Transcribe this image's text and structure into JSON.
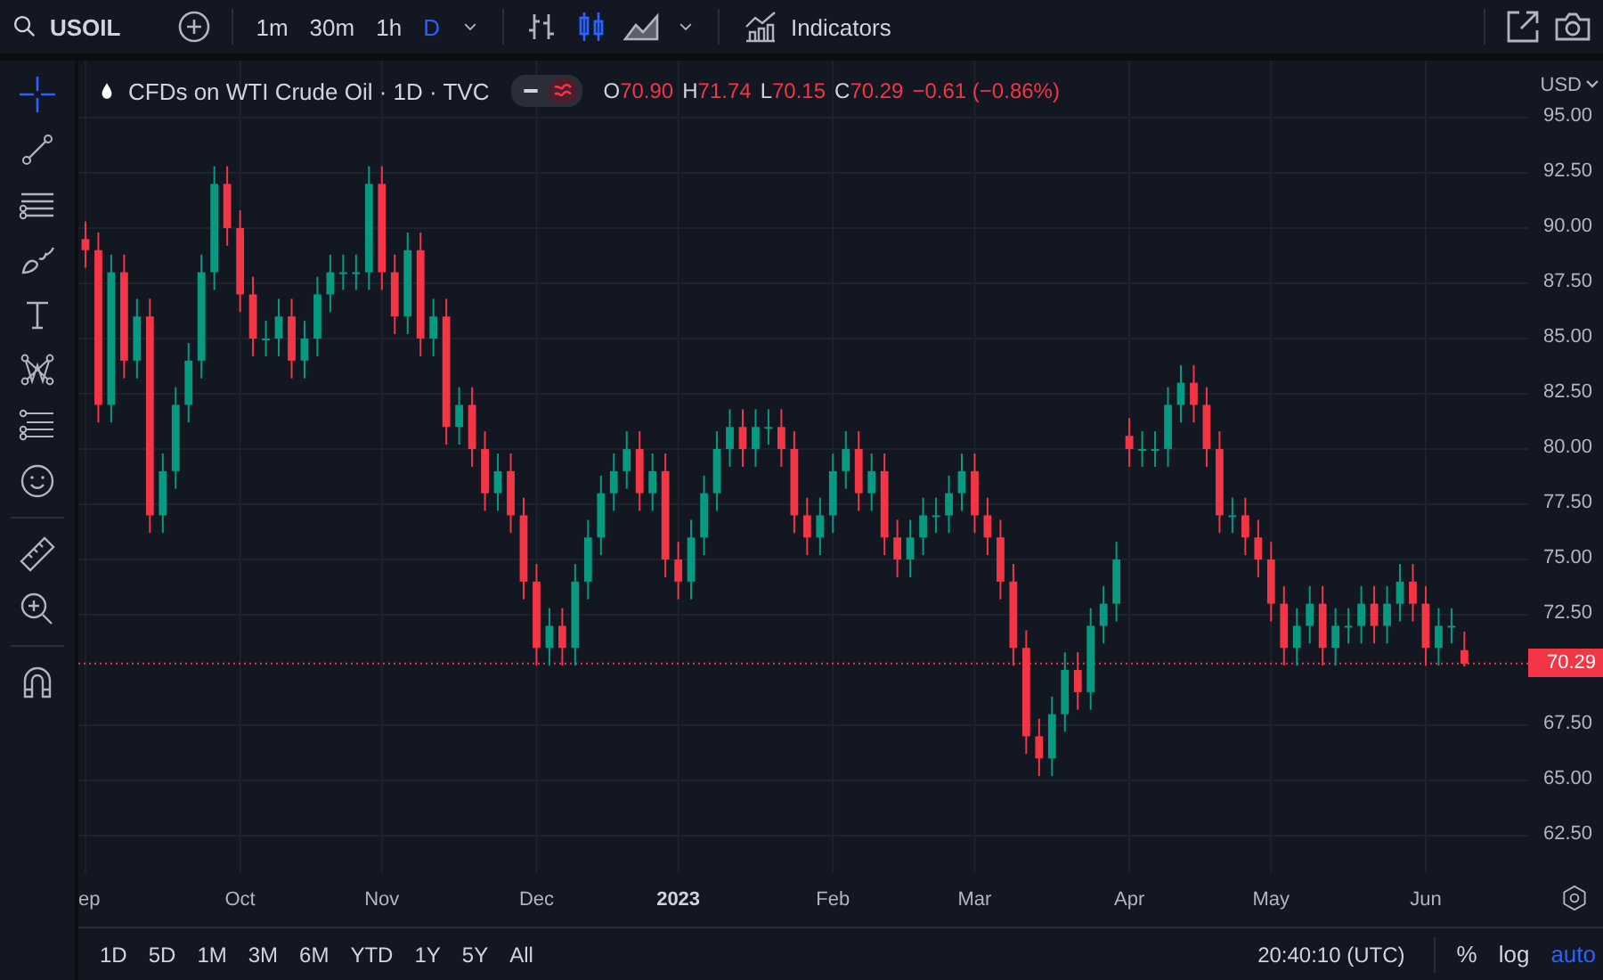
{
  "toolbar": {
    "symbol": "USOIL",
    "intervals": [
      {
        "label": "1m",
        "selected": false
      },
      {
        "label": "30m",
        "selected": false
      },
      {
        "label": "1h",
        "selected": false
      },
      {
        "label": "D",
        "selected": true
      }
    ],
    "chart_styles": [
      {
        "kind": "bars",
        "selected": false
      },
      {
        "kind": "candles",
        "selected": true
      },
      {
        "kind": "area",
        "selected": false
      }
    ],
    "indicators_label": "Indicators"
  },
  "legend": {
    "title": "CFDs on WTI Crude Oil · 1D · TVC",
    "toggles": [
      {
        "kind": "minus",
        "on": false
      },
      {
        "kind": "wave",
        "on": true
      }
    ],
    "ohlc": [
      {
        "key": "O",
        "value": "70.90"
      },
      {
        "key": "H",
        "value": "71.74"
      },
      {
        "key": "L",
        "value": "70.15"
      },
      {
        "key": "C",
        "value": "70.29"
      }
    ],
    "change": "−0.61 (−0.86%)"
  },
  "price_axis": {
    "currency": "USD",
    "last_price": "70.29"
  },
  "chart_data": {
    "type": "candlestick",
    "grid": true,
    "ylim": [
      60.81,
      97.58
    ],
    "categories": [
      "ep",
      null,
      null,
      null,
      null,
      null,
      null,
      null,
      null,
      null,
      null,
      null,
      "Oct",
      null,
      null,
      null,
      null,
      null,
      null,
      null,
      null,
      null,
      null,
      "Nov",
      null,
      null,
      null,
      null,
      null,
      null,
      null,
      null,
      null,
      null,
      null,
      "Dec",
      null,
      null,
      null,
      null,
      null,
      null,
      null,
      null,
      null,
      null,
      "2023",
      null,
      null,
      null,
      null,
      null,
      null,
      null,
      null,
      null,
      null,
      null,
      "Feb",
      null,
      null,
      null,
      null,
      null,
      null,
      null,
      null,
      null,
      null,
      "Mar",
      null,
      null,
      null,
      null,
      null,
      null,
      null,
      null,
      null,
      null,
      null,
      "Apr",
      null,
      null,
      null,
      null,
      null,
      null,
      null,
      null,
      null,
      null,
      "May",
      null,
      null,
      null,
      null,
      null,
      null,
      null,
      null,
      null,
      null,
      null,
      "Jun",
      null,
      null,
      null
    ],
    "ref_lines": [
      {
        "axis": "y",
        "value": 70.29
      }
    ],
    "yticks": [
      {
        "value": 95,
        "label": "95.00"
      },
      {
        "value": 92.5,
        "label": "92.50"
      },
      {
        "value": 90,
        "label": "90.00"
      },
      {
        "value": 87.5,
        "label": "87.50"
      },
      {
        "value": 85,
        "label": "85.00"
      },
      {
        "value": 82.5,
        "label": "82.50"
      },
      {
        "value": 80,
        "label": "80.00"
      },
      {
        "value": 77.5,
        "label": "77.50"
      },
      {
        "value": 75,
        "label": "75.00"
      },
      {
        "value": 72.5,
        "label": "72.50"
      },
      {
        "value": 67.5,
        "label": "67.50"
      },
      {
        "value": 65,
        "label": "65.00"
      },
      {
        "value": 62.5,
        "label": "62.50"
      }
    ],
    "ohlc": [
      [
        89.5,
        90.3,
        88.2,
        89
      ],
      [
        89,
        89.8,
        81.2,
        82
      ],
      [
        82,
        88.8,
        81.2,
        88
      ],
      [
        88,
        88.8,
        83.2,
        84
      ],
      [
        84,
        86.8,
        83.2,
        86
      ],
      [
        86,
        86.8,
        76.2,
        77
      ],
      [
        77,
        79.8,
        76.2,
        79
      ],
      [
        79,
        82.8,
        78.2,
        82
      ],
      [
        82,
        84.8,
        81.2,
        84
      ],
      [
        84,
        88.8,
        83.2,
        88
      ],
      [
        88,
        92.8,
        87.2,
        92
      ],
      [
        92,
        92.8,
        89.2,
        90
      ],
      [
        90,
        90.8,
        86.2,
        87
      ],
      [
        87,
        87.8,
        84.2,
        85
      ],
      [
        85,
        85.8,
        84.2,
        85
      ],
      [
        85,
        86.8,
        84.2,
        86
      ],
      [
        86,
        86.8,
        83.2,
        84
      ],
      [
        84,
        85.8,
        83.2,
        85
      ],
      [
        85,
        87.8,
        84.2,
        87
      ],
      [
        87,
        88.8,
        86.2,
        88
      ],
      [
        88,
        88.8,
        87.2,
        88
      ],
      [
        88,
        88.8,
        87.2,
        88
      ],
      [
        88,
        92.8,
        87.2,
        92
      ],
      [
        92,
        92.8,
        87.2,
        88
      ],
      [
        88,
        88.8,
        85.2,
        86
      ],
      [
        86,
        89.8,
        85.2,
        89
      ],
      [
        89,
        89.8,
        84.2,
        85
      ],
      [
        85,
        86.8,
        84.2,
        86
      ],
      [
        86,
        86.8,
        80.2,
        81
      ],
      [
        81,
        82.8,
        80.2,
        82
      ],
      [
        82,
        82.8,
        79.2,
        80
      ],
      [
        80,
        80.8,
        77.2,
        78
      ],
      [
        78,
        79.8,
        77.2,
        79
      ],
      [
        79,
        79.8,
        76.2,
        77
      ],
      [
        77,
        77.8,
        73.2,
        74
      ],
      [
        74,
        74.8,
        70.2,
        71
      ],
      [
        71,
        72.8,
        70.2,
        72
      ],
      [
        72,
        72.8,
        70.2,
        71
      ],
      [
        71,
        74.8,
        70.2,
        74
      ],
      [
        74,
        76.8,
        73.2,
        76
      ],
      [
        76,
        78.8,
        75.2,
        78
      ],
      [
        78,
        79.8,
        77.2,
        79
      ],
      [
        79,
        80.8,
        78.2,
        80
      ],
      [
        80,
        80.8,
        77.2,
        78
      ],
      [
        78,
        79.8,
        77.2,
        79
      ],
      [
        79,
        79.8,
        74.2,
        75
      ],
      [
        75,
        75.8,
        73.2,
        74
      ],
      [
        74,
        76.8,
        73.2,
        76
      ],
      [
        76,
        78.8,
        75.2,
        78
      ],
      [
        78,
        80.8,
        77.2,
        80
      ],
      [
        80,
        81.8,
        79.2,
        81
      ],
      [
        81,
        81.8,
        79.2,
        80
      ],
      [
        80,
        81.8,
        79.2,
        81
      ],
      [
        81,
        81.8,
        80.2,
        81
      ],
      [
        81,
        81.8,
        79.2,
        80
      ],
      [
        80,
        80.8,
        76.2,
        77
      ],
      [
        77,
        77.8,
        75.2,
        76
      ],
      [
        76,
        77.8,
        75.2,
        77
      ],
      [
        77,
        79.8,
        76.2,
        79
      ],
      [
        79,
        80.8,
        78.2,
        80
      ],
      [
        80,
        80.8,
        77.2,
        78
      ],
      [
        78,
        79.8,
        77.2,
        79
      ],
      [
        79,
        79.8,
        75.2,
        76
      ],
      [
        76,
        76.8,
        74.2,
        75
      ],
      [
        75,
        76.8,
        74.2,
        76
      ],
      [
        76,
        77.8,
        75.2,
        77
      ],
      [
        77,
        77.8,
        76.2,
        77
      ],
      [
        77,
        78.8,
        76.2,
        78
      ],
      [
        78,
        79.8,
        77.2,
        79
      ],
      [
        79,
        79.8,
        76.2,
        77
      ],
      [
        77,
        77.8,
        75.2,
        76
      ],
      [
        76,
        76.8,
        73.2,
        74
      ],
      [
        74,
        74.8,
        70.2,
        71
      ],
      [
        71,
        71.8,
        66.2,
        67
      ],
      [
        67,
        67.8,
        65.2,
        66
      ],
      [
        66,
        68.8,
        65.2,
        68
      ],
      [
        68,
        70.8,
        67.2,
        70
      ],
      [
        70,
        70.8,
        68.2,
        69
      ],
      [
        69,
        72.8,
        68.2,
        72
      ],
      [
        72,
        73.8,
        71.2,
        73
      ],
      [
        73,
        75.8,
        72.2,
        75
      ],
      [
        80.6,
        81.4,
        79.2,
        80
      ],
      [
        80,
        80.8,
        79.2,
        80
      ],
      [
        80,
        80.8,
        79.2,
        80
      ],
      [
        80,
        82.8,
        79.2,
        82
      ],
      [
        82,
        83.8,
        81.2,
        83
      ],
      [
        83,
        83.8,
        81.2,
        82
      ],
      [
        82,
        82.8,
        79.2,
        80
      ],
      [
        80,
        80.8,
        76.2,
        77
      ],
      [
        77,
        77.8,
        76.2,
        77
      ],
      [
        77,
        77.8,
        75.2,
        76
      ],
      [
        76,
        76.8,
        74.2,
        75
      ],
      [
        75,
        75.8,
        72.2,
        73
      ],
      [
        73,
        73.8,
        70.2,
        71
      ],
      [
        71,
        72.8,
        70.2,
        72
      ],
      [
        72,
        73.8,
        71.2,
        73
      ],
      [
        73,
        73.8,
        70.2,
        71
      ],
      [
        71,
        72.8,
        70.2,
        72
      ],
      [
        72,
        72.8,
        71.2,
        72
      ],
      [
        72,
        73.8,
        71.2,
        73
      ],
      [
        73,
        73.8,
        71.2,
        72
      ],
      [
        72,
        73.8,
        71.2,
        73
      ],
      [
        73,
        74.8,
        72.2,
        74
      ],
      [
        74,
        74.8,
        72.2,
        73
      ],
      [
        73,
        73.8,
        70.2,
        71
      ],
      [
        71,
        72.8,
        70.2,
        72
      ],
      [
        72,
        72.8,
        71.2,
        72
      ],
      [
        70.9,
        71.74,
        70.15,
        70.29
      ]
    ]
  },
  "bottom_bar": {
    "ranges": [
      "1D",
      "5D",
      "1M",
      "3M",
      "6M",
      "YTD",
      "1Y",
      "5Y",
      "All"
    ],
    "time": "20:40:10 (UTC)",
    "scale_options": [
      {
        "label": "%",
        "on": false
      },
      {
        "label": "log",
        "on": false
      },
      {
        "label": "auto",
        "on": true
      }
    ]
  }
}
